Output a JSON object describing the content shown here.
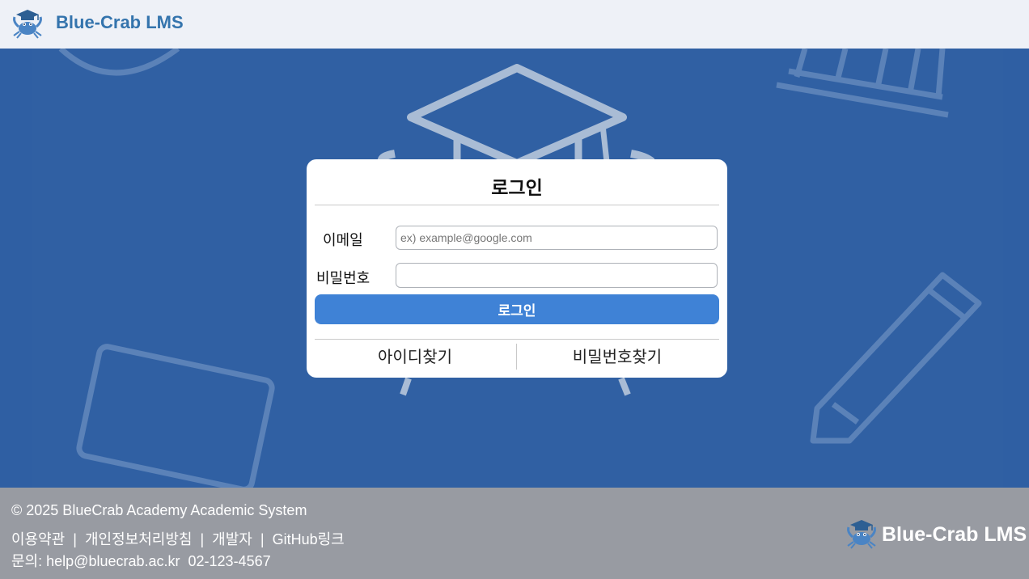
{
  "header": {
    "brand": "Blue-Crab LMS",
    "logo_icon": "crab-graduation-cap-icon"
  },
  "login": {
    "title": "로그인",
    "email_label": "이메일",
    "email_placeholder": "ex) example@google.com",
    "email_value": "",
    "password_label": "비밀번호",
    "password_value": "",
    "submit_label": "로그인",
    "find_id_label": "아이디찾기",
    "find_password_label": "비밀번호찾기"
  },
  "footer": {
    "copyright": "© 2025 BlueCrab Academy Academic System",
    "links": [
      "이용약관",
      "개인정보처리방침",
      "개발자",
      "GitHub링크"
    ],
    "link_separator": "|",
    "contact_label": "문의:",
    "contact_email": "help@bluecrab.ac.kr",
    "contact_phone": "02-123-4567",
    "brand": "Blue-Crab LMS"
  },
  "colors": {
    "brand_text": "#3474ad",
    "hero_bg": "#2f5fa3",
    "button": "#3f82d6",
    "footer_bg": "#989ba2"
  }
}
